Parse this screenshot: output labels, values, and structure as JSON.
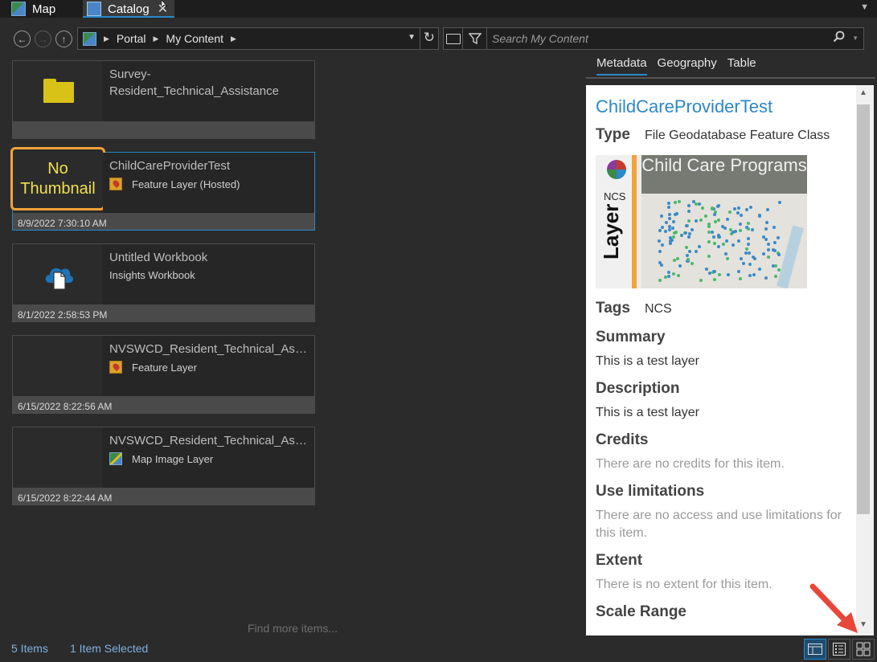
{
  "tabs": [
    {
      "label": "Map",
      "icon": "map-icon"
    },
    {
      "label": "Catalog",
      "icon": "catalog-icon",
      "close": "✕"
    }
  ],
  "toolbar": {
    "path": [
      "Portal",
      "My Content"
    ],
    "search_placeholder": "Search My Content"
  },
  "items": [
    {
      "title": "Survey-Resident_Technical_Assistance",
      "type": "",
      "date": "",
      "thumb": "folder-icon"
    },
    {
      "title": "ChildCareProviderTest",
      "type": "Feature Layer (Hosted)",
      "date": "8/9/2022 7:30:10 AM",
      "thumb_text": "No Thumbnail",
      "selected": true
    },
    {
      "title": "Untitled Workbook",
      "type": "Insights Workbook",
      "date": "8/1/2022 2:58:53 PM",
      "thumb": "cloud-document-icon"
    },
    {
      "title": "NVSWCD_Resident_Technical_Assi...",
      "type": "Feature Layer",
      "date": "6/15/2022 8:22:56 AM"
    },
    {
      "title": "NVSWCD_Resident_Technical_Assi...",
      "type": "Map Image Layer",
      "date": "6/15/2022 8:22:44 AM"
    }
  ],
  "find_more": "Find more items...",
  "status": {
    "count": "5 Items",
    "selected": "1 Item Selected"
  },
  "details": {
    "tabs": [
      "Metadata",
      "Geography",
      "Table"
    ],
    "title": "ChildCareProviderTest",
    "type_label": "Type",
    "type_value": "File Geodatabase Feature Class",
    "thumbnail": {
      "header": "Child Care Programs",
      "brand": "NCS",
      "side_text": "Layer"
    },
    "tags_label": "Tags",
    "tags_value": "NCS",
    "summary_label": "Summary",
    "summary": "This is a test layer",
    "description_label": "Description",
    "description": "This is a test layer",
    "credits_label": "Credits",
    "credits": "There are no credits for this item.",
    "use_label": "Use limitations",
    "use": "There are no access and use limitations for this item.",
    "extent_label": "Extent",
    "extent": "There is no extent for this item.",
    "next_label": "Scale Range"
  },
  "colors": {
    "accent": "#2b87c9",
    "highlight": "#f2a33a",
    "annotation_arrow": "#e8463a"
  }
}
